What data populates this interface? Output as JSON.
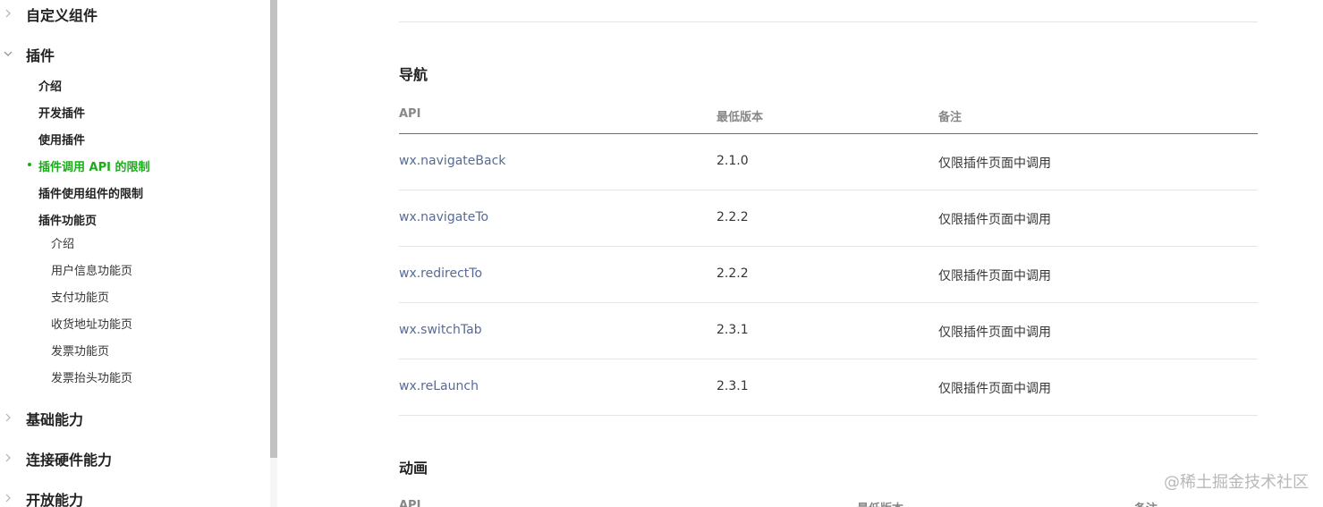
{
  "sidebar": {
    "groups": [
      {
        "label": "自定义组件",
        "expanded": false
      },
      {
        "label": "插件",
        "expanded": true
      },
      {
        "label": "基础能力",
        "expanded": false
      },
      {
        "label": "连接硬件能力",
        "expanded": false
      },
      {
        "label": "开放能力",
        "expanded": false
      }
    ],
    "plugin_items": [
      {
        "label": "介绍"
      },
      {
        "label": "开发插件"
      },
      {
        "label": "使用插件"
      },
      {
        "label": "插件调用 API 的限制",
        "active": true
      },
      {
        "label": "插件使用组件的限制"
      },
      {
        "label": "插件功能页"
      }
    ],
    "feature_page_items": [
      {
        "label": "介绍"
      },
      {
        "label": "用户信息功能页"
      },
      {
        "label": "支付功能页"
      },
      {
        "label": "收货地址功能页"
      },
      {
        "label": "发票功能页"
      },
      {
        "label": "发票抬头功能页"
      }
    ],
    "active_color": "#1aad19"
  },
  "main": {
    "nav_section": {
      "title": "导航",
      "headers": [
        "API",
        "最低版本",
        "备注"
      ],
      "rows": [
        {
          "api": "wx.navigateBack",
          "version": "2.1.0",
          "note": "仅限插件页面中调用"
        },
        {
          "api": "wx.navigateTo",
          "version": "2.2.2",
          "note": "仅限插件页面中调用"
        },
        {
          "api": "wx.redirectTo",
          "version": "2.2.2",
          "note": "仅限插件页面中调用"
        },
        {
          "api": "wx.switchTab",
          "version": "2.3.1",
          "note": "仅限插件页面中调用"
        },
        {
          "api": "wx.reLaunch",
          "version": "2.3.1",
          "note": "仅限插件页面中调用"
        }
      ]
    },
    "anim_section": {
      "title": "动画",
      "headers": [
        "API",
        "最低版本",
        "备注"
      ]
    },
    "link_color": "#576b95"
  },
  "watermark": "@稀土掘金技术社区"
}
